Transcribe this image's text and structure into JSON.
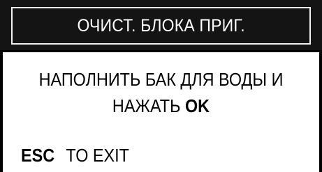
{
  "header": {
    "title": "ОЧИСТ. БЛОКА ПРИГ."
  },
  "message": {
    "line1": "НАПОЛНИТЬ БАК ДЛЯ ВОДЫ И",
    "line2_prefix": "НАЖАТЬ ",
    "confirm_key": "OK"
  },
  "footer": {
    "esc_key": "ESC",
    "exit_label": "TO EXIT"
  },
  "colors": {
    "header_background": "#141414",
    "header_text": "#ffffff",
    "body_background": "#ffffff",
    "text": "#000000"
  }
}
